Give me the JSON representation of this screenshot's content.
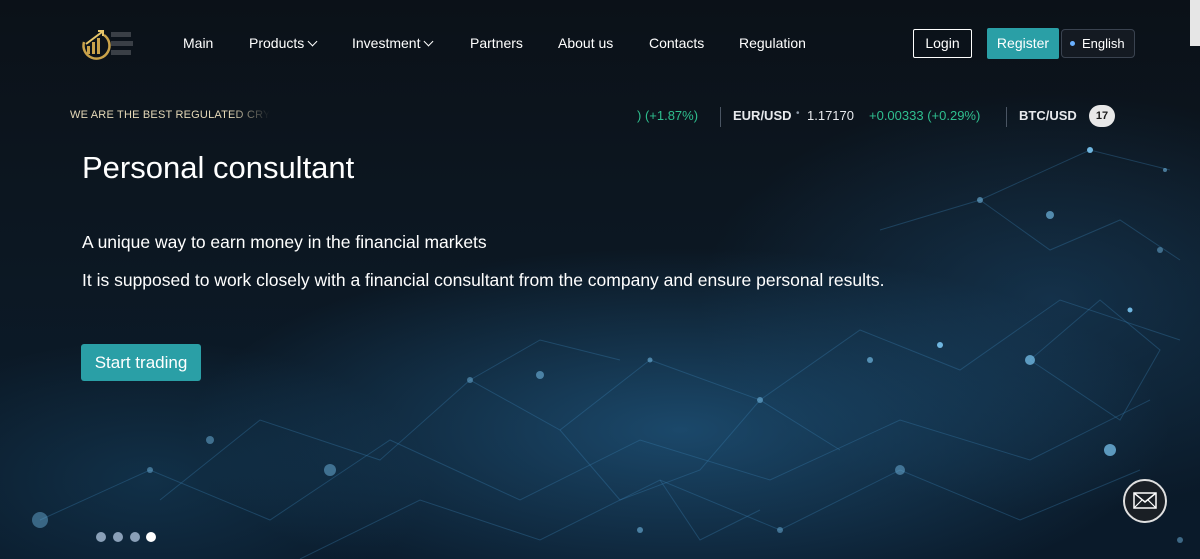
{
  "nav": {
    "items": [
      {
        "label": "Main",
        "has_dropdown": false
      },
      {
        "label": "Products",
        "has_dropdown": true
      },
      {
        "label": "Investment",
        "has_dropdown": true
      },
      {
        "label": "Partners",
        "has_dropdown": false
      },
      {
        "label": "About us",
        "has_dropdown": false
      },
      {
        "label": "Contacts",
        "has_dropdown": false
      },
      {
        "label": "Regulation",
        "has_dropdown": false
      }
    ],
    "login_label": "Login",
    "register_label": "Register",
    "language": "English"
  },
  "marquee": {
    "text": "WE ARE THE BEST REGULATED CRYPTO"
  },
  "ticker": {
    "prev_change": ") (+1.87%)",
    "items": [
      {
        "symbol": "EUR/USD",
        "price": "1.17170",
        "change": "+0.00333 (+0.29%)"
      },
      {
        "symbol": "BTC/USD",
        "price": "",
        "change": ""
      }
    ],
    "widget_logo": "17"
  },
  "hero": {
    "title": "Personal consultant",
    "line1": "A unique way to earn money in the financial markets",
    "line2": "It is supposed to work closely with a financial consultant from the company and ensure personal results.",
    "cta_label": "Start trading"
  },
  "slider": {
    "count": 4,
    "active_index": 3
  },
  "icons": {
    "logo": "growth-chart-logo-icon",
    "mail": "envelope-icon",
    "dropdown": "chevron-down-icon"
  },
  "colors": {
    "accent": "#2a9fa6",
    "ticker_up": "#2fbf8f",
    "background": "#0a1420"
  }
}
